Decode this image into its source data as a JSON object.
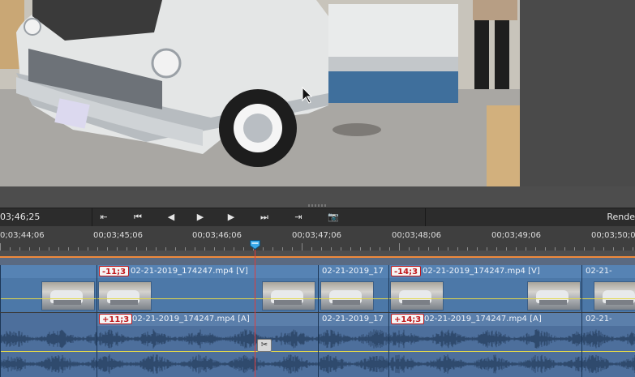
{
  "transport": {
    "timecode": "03;46;25",
    "render_label": "Rende",
    "buttons": [
      {
        "name": "mark-in-button",
        "icon": "mark-in-icon",
        "glyph": "⇤"
      },
      {
        "name": "go-to-start-button",
        "icon": "skip-back-icon",
        "glyph": "⏮"
      },
      {
        "name": "previous-frame-button",
        "icon": "step-back-icon",
        "glyph": "◀"
      },
      {
        "name": "play-button",
        "icon": "play-icon",
        "glyph": "▶"
      },
      {
        "name": "next-frame-button",
        "icon": "step-forward-icon",
        "glyph": "▶"
      },
      {
        "name": "go-to-end-button",
        "icon": "skip-forward-icon",
        "glyph": "⏭"
      },
      {
        "name": "mark-out-button",
        "icon": "mark-out-icon",
        "glyph": "⇥"
      },
      {
        "name": "snapshot-button",
        "icon": "camera-icon",
        "glyph": "📷"
      }
    ]
  },
  "ruler": {
    "ticks": [
      "0;03;44;06",
      "00;03;45;06",
      "00;03;46;06",
      "00;03;47;06",
      "00;03;48;06",
      "00;03;49;06",
      "00;03;50;0"
    ]
  },
  "video_track": {
    "clips": [
      {
        "name": "",
        "badge": ""
      },
      {
        "name": "02-21-2019_174247.mp4 [V]",
        "badge": "-11;3"
      },
      {
        "name": "02-21-2019_17",
        "badge": ""
      },
      {
        "name": "02-21-2019_174247.mp4 [V]",
        "badge": "-14;3"
      },
      {
        "name": "02-21-",
        "badge": ""
      }
    ]
  },
  "audio_track": {
    "clips": [
      {
        "name": "",
        "badge": ""
      },
      {
        "name": "02-21-2019_174247.mp4 [A]",
        "badge": "+11;3"
      },
      {
        "name": "02-21-2019_17",
        "badge": ""
      },
      {
        "name": "02-21-2019_174247.mp4 [A]",
        "badge": "+14;3"
      },
      {
        "name": "02-21-",
        "badge": ""
      }
    ]
  },
  "colors": {
    "video_clip": "#4c78a8",
    "audio_clip": "#4d6f9c",
    "playhead": "#e03c3c",
    "sync_badge_text": "#c0181c",
    "work_area": "#f08a3c"
  }
}
